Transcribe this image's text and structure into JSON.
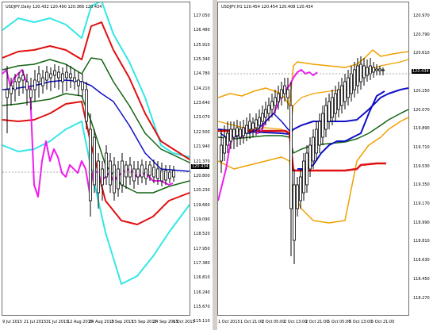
{
  "left_chart": {
    "symbol_line": "USDJPY,Daily  120.432 120.490 120.366 120.434",
    "current_price": "120.434",
    "y_labels": [
      "127.050",
      "126.480",
      "125.910",
      "125.340",
      "124.780",
      "124.210",
      "123.640",
      "123.070",
      "122.500",
      "121.940",
      "121.370",
      "120.800",
      "120.230",
      "119.660",
      "119.090",
      "118.520",
      "117.950",
      "117.380",
      "116.810",
      "116.240",
      "115.670",
      "115.110"
    ],
    "x_labels": [
      "9 Jul 2015",
      "21 Jul 2015",
      "31 Jul 2015",
      "12 Aug 2015",
      "24 Aug 2015",
      "3 Sep 2015",
      "15 Sep 2015",
      "24 Sep 2015",
      "6 Oct 2015"
    ],
    "colors": {
      "cyan": "#33e6e6",
      "red": "#e01010",
      "green": "#146414",
      "blue": "#1010c8",
      "magenta": "#f01cf0",
      "candle": "#000000"
    }
  },
  "right_chart": {
    "symbol_line": "USDJPY,H1  120.454 120.454 120.408 120.434",
    "current_price": "120.434",
    "y_labels": [
      "120.970",
      "120.790",
      "120.610",
      "120.430",
      "120.250",
      "120.070",
      "119.890",
      "119.710",
      "119.530",
      "119.350",
      "119.170",
      "118.990",
      "118.810",
      "118.630",
      "118.450",
      "118.270"
    ],
    "x_labels": [
      "1 Oct 2015",
      "1 Oct 21:00",
      "2 Oct 05:00",
      "2 Oct 13:00",
      "2 Oct 21:00",
      "5 Oct 05:00",
      "5 Oct 13:00",
      "5 Oct 21:00"
    ],
    "colors": {
      "orange": "#f0a000",
      "red": "#e01010",
      "green": "#146414",
      "blue": "#1010c8",
      "magenta": "#f01cf0",
      "candle": "#000000"
    }
  }
}
